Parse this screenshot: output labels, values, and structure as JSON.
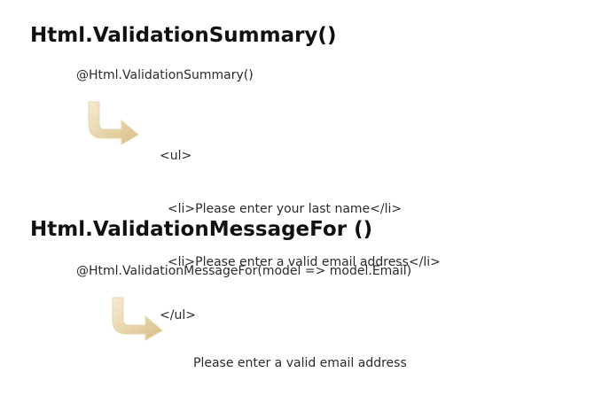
{
  "sections": [
    {
      "heading": "Html.ValidationSummary()",
      "code": "@Html.ValidationSummary()",
      "output_lines": [
        "<ul>",
        "  <li>Please enter your last name</li>",
        "  <li>Please enter a valid email address</li>",
        "</ul>"
      ]
    },
    {
      "heading": "Html.ValidationMessageFor ()",
      "code": "@Html.ValidationMessageFor(model => model.Email)",
      "output_lines": [
        "Please enter a valid email address"
      ]
    }
  ],
  "arrow_icon": "curved-right-arrow-icon",
  "colors": {
    "arrow_light": "#f7ecd2",
    "arrow_dark": "#d9bf86",
    "text": "#111111"
  }
}
